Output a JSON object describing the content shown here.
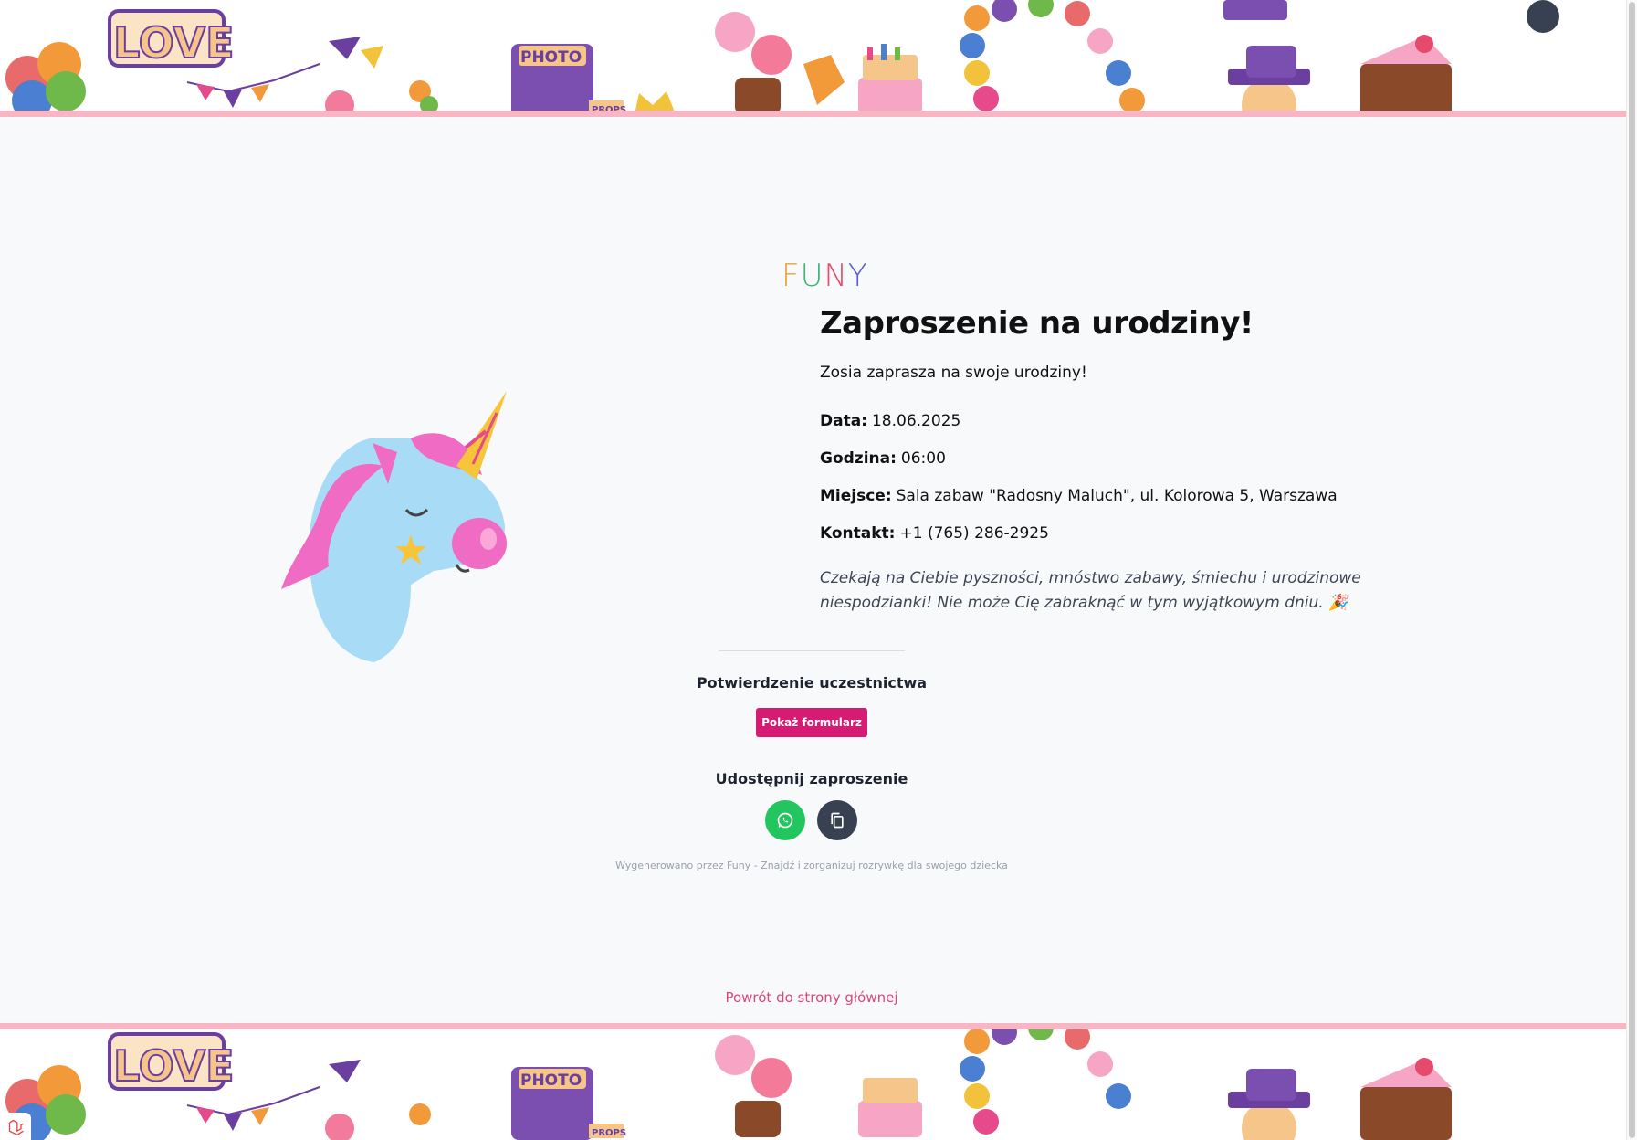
{
  "brand": {
    "logo_letters": [
      "F",
      "U",
      "N",
      "Y"
    ],
    "logo_colors": [
      "#e8a23a",
      "#3bb273",
      "#e64a6b",
      "#5b5bd6"
    ]
  },
  "banner": {
    "love_text": "LOVE",
    "photo_text": "PHOTO",
    "props_text": "PROPS"
  },
  "invitation": {
    "title": "Zaproszenie na urodziny!",
    "intro": "Zosia zaprasza na swoje urodziny!",
    "details": [
      {
        "label": "Data:",
        "value": "18.06.2025"
      },
      {
        "label": "Godzina:",
        "value": "06:00"
      },
      {
        "label": "Miejsce:",
        "value": "Sala zabaw \"Radosny Maluch\", ul. Kolorowa 5, Warszawa"
      },
      {
        "label": "Kontakt:",
        "value": "+1 (765) 286-2925"
      }
    ],
    "closing": "Czekają na Ciebie pyszności, mnóstwo zabawy, śmiechu i urodzinowe niespodzianki! Nie może Cię zabraknąć w tym wyjątkowym dniu. 🎉"
  },
  "rsvp": {
    "title": "Potwierdzenie uczestnictwa",
    "button_label": "Pokaż formularz"
  },
  "share": {
    "title": "Udostępnij zaproszenie",
    "whatsapp_icon": "whatsapp-icon",
    "copy_icon": "copy-icon"
  },
  "footer": {
    "note": "Wygenerowano przez Funy - Znajdź i zorganizuj rozrywkę dla swojego dziecka",
    "back_link": "Powrót do strony głównej"
  },
  "colors": {
    "accent": "#d81b72",
    "whatsapp": "#22c55e",
    "copy": "#374151",
    "stripe": "#f8b6c5"
  }
}
